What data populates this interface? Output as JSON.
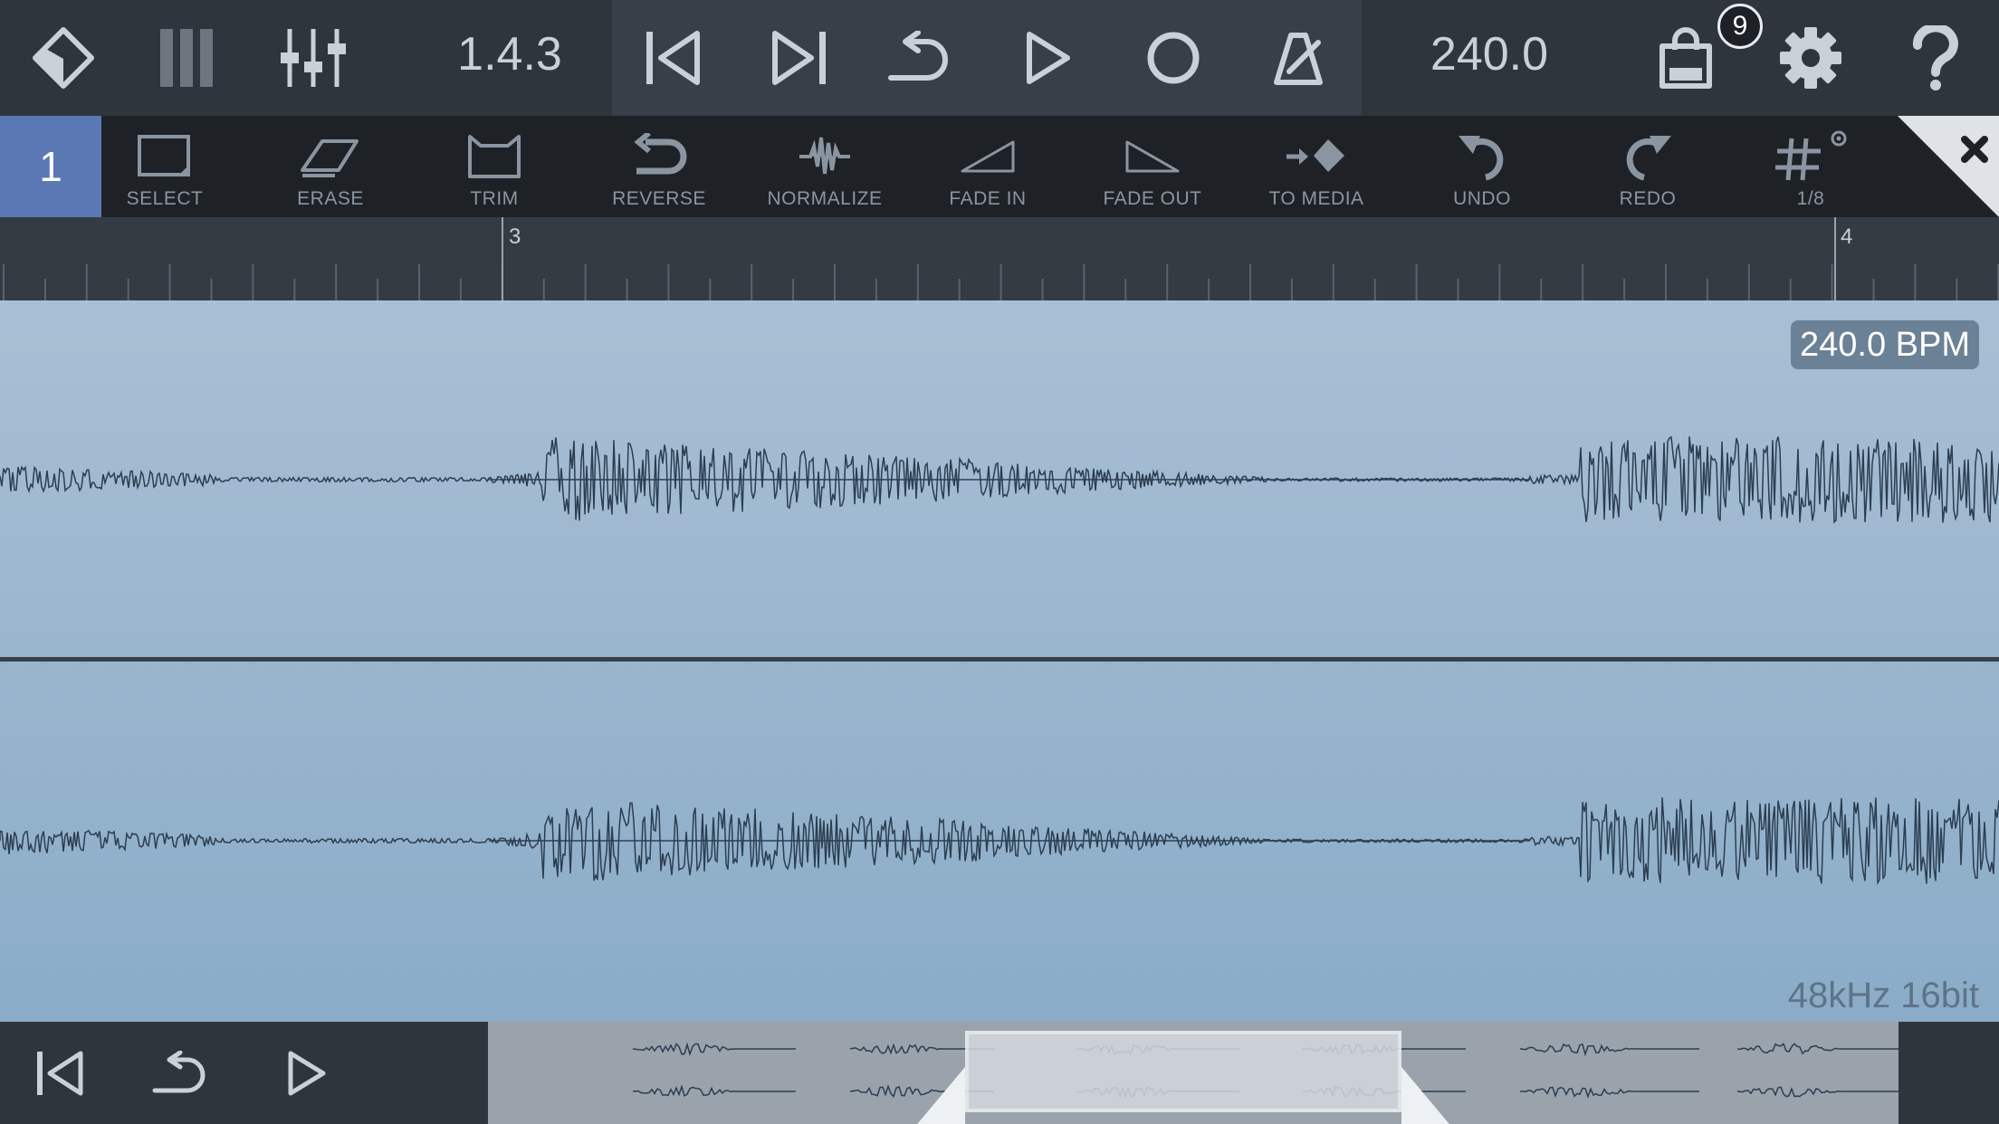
{
  "header": {
    "position": "1.4.3",
    "tempo": "240.0",
    "cart_badge": "9"
  },
  "toolbar": {
    "track_number": "1",
    "tools": [
      {
        "label": "SELECT",
        "icon": "select-icon"
      },
      {
        "label": "ERASE",
        "icon": "eraser-icon"
      },
      {
        "label": "TRIM",
        "icon": "trim-icon"
      },
      {
        "label": "REVERSE",
        "icon": "reverse-icon"
      },
      {
        "label": "NORMALIZE",
        "icon": "normalize-icon"
      },
      {
        "label": "FADE IN",
        "icon": "fade-in-icon"
      },
      {
        "label": "FADE OUT",
        "icon": "fade-out-icon"
      },
      {
        "label": "TO MEDIA",
        "icon": "to-media-icon"
      },
      {
        "label": "UNDO",
        "icon": "undo-icon"
      },
      {
        "label": "REDO",
        "icon": "redo-icon"
      },
      {
        "label": "1/8",
        "icon": "grid-icon"
      }
    ]
  },
  "ruler": {
    "bar_3": "3",
    "bar_4": "4"
  },
  "editor": {
    "bpm_label": "240.0 BPM",
    "format_label": "48kHz 16bit"
  },
  "colors": {
    "accent": "#5a78b4",
    "waveform": "#2c3e50",
    "background_top": "#a9bfd4",
    "background_bottom": "#8aacc8"
  }
}
